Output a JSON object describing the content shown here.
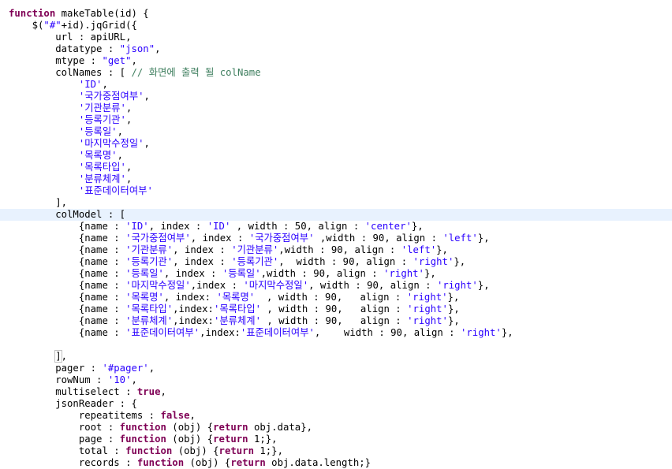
{
  "code_lines": [
    [
      {
        "t": "function",
        "c": "kw"
      },
      {
        "t": " makeTable(id) {",
        "c": "tx"
      }
    ],
    [
      {
        "t": "    $(",
        "c": "tx"
      },
      {
        "t": "\"#\"",
        "c": "str"
      },
      {
        "t": "+id).jqGrid({",
        "c": "tx"
      }
    ],
    [
      {
        "t": "        url : apiURL,",
        "c": "tx"
      }
    ],
    [
      {
        "t": "        datatype : ",
        "c": "tx"
      },
      {
        "t": "\"json\"",
        "c": "str"
      },
      {
        "t": ",",
        "c": "tx"
      }
    ],
    [
      {
        "t": "        mtype : ",
        "c": "tx"
      },
      {
        "t": "\"get\"",
        "c": "str"
      },
      {
        "t": ",",
        "c": "tx"
      }
    ],
    [
      {
        "t": "        colNames : [ ",
        "c": "tx"
      },
      {
        "t": "// 화면에 출력 될 colName",
        "c": "cm"
      }
    ],
    [
      {
        "t": "            ",
        "c": "tx"
      },
      {
        "t": "'ID'",
        "c": "str"
      },
      {
        "t": ",",
        "c": "tx"
      }
    ],
    [
      {
        "t": "            ",
        "c": "tx"
      },
      {
        "t": "'국가중점여부'",
        "c": "str"
      },
      {
        "t": ",",
        "c": "tx"
      }
    ],
    [
      {
        "t": "            ",
        "c": "tx"
      },
      {
        "t": "'기관분류'",
        "c": "str"
      },
      {
        "t": ",",
        "c": "tx"
      }
    ],
    [
      {
        "t": "            ",
        "c": "tx"
      },
      {
        "t": "'등록기관'",
        "c": "str"
      },
      {
        "t": ",",
        "c": "tx"
      }
    ],
    [
      {
        "t": "            ",
        "c": "tx"
      },
      {
        "t": "'등록일'",
        "c": "str"
      },
      {
        "t": ",",
        "c": "tx"
      }
    ],
    [
      {
        "t": "            ",
        "c": "tx"
      },
      {
        "t": "'마지막수정일'",
        "c": "str"
      },
      {
        "t": ",",
        "c": "tx"
      }
    ],
    [
      {
        "t": "            ",
        "c": "tx"
      },
      {
        "t": "'목록명'",
        "c": "str"
      },
      {
        "t": ",",
        "c": "tx"
      }
    ],
    [
      {
        "t": "            ",
        "c": "tx"
      },
      {
        "t": "'목록타입'",
        "c": "str"
      },
      {
        "t": ",",
        "c": "tx"
      }
    ],
    [
      {
        "t": "            ",
        "c": "tx"
      },
      {
        "t": "'분류체계'",
        "c": "str"
      },
      {
        "t": ",",
        "c": "tx"
      }
    ],
    [
      {
        "t": "            ",
        "c": "tx"
      },
      {
        "t": "'표준데이터여부'",
        "c": "str"
      }
    ],
    [
      {
        "t": "        ],",
        "c": "tx"
      }
    ],
    [
      {
        "t": "        colModel : [",
        "c": "tx"
      }
    ],
    [
      {
        "t": "            {name : ",
        "c": "tx"
      },
      {
        "t": "'ID'",
        "c": "str"
      },
      {
        "t": ", index : ",
        "c": "tx"
      },
      {
        "t": "'ID'",
        "c": "str"
      },
      {
        "t": " , width : 50, align : ",
        "c": "tx"
      },
      {
        "t": "'center'",
        "c": "str"
      },
      {
        "t": "},",
        "c": "tx"
      }
    ],
    [
      {
        "t": "            {name : ",
        "c": "tx"
      },
      {
        "t": "'국가중점여부'",
        "c": "str"
      },
      {
        "t": ", index : ",
        "c": "tx"
      },
      {
        "t": "'국가중점여부'",
        "c": "str"
      },
      {
        "t": " ,width : 90, align : ",
        "c": "tx"
      },
      {
        "t": "'left'",
        "c": "str"
      },
      {
        "t": "},",
        "c": "tx"
      }
    ],
    [
      {
        "t": "            {name : ",
        "c": "tx"
      },
      {
        "t": "'기관분류'",
        "c": "str"
      },
      {
        "t": ", index : ",
        "c": "tx"
      },
      {
        "t": "'기관분류'",
        "c": "str"
      },
      {
        "t": ",width : 90, align : ",
        "c": "tx"
      },
      {
        "t": "'left'",
        "c": "str"
      },
      {
        "t": "},",
        "c": "tx"
      }
    ],
    [
      {
        "t": "            {name : ",
        "c": "tx"
      },
      {
        "t": "'등록기관'",
        "c": "str"
      },
      {
        "t": ", index : ",
        "c": "tx"
      },
      {
        "t": "'등록기관'",
        "c": "str"
      },
      {
        "t": ",  width : 90, align : ",
        "c": "tx"
      },
      {
        "t": "'right'",
        "c": "str"
      },
      {
        "t": "},",
        "c": "tx"
      }
    ],
    [
      {
        "t": "            {name : ",
        "c": "tx"
      },
      {
        "t": "'등록일'",
        "c": "str"
      },
      {
        "t": ", index : ",
        "c": "tx"
      },
      {
        "t": "'등록일'",
        "c": "str"
      },
      {
        "t": ",width : 90, align : ",
        "c": "tx"
      },
      {
        "t": "'right'",
        "c": "str"
      },
      {
        "t": "},",
        "c": "tx"
      }
    ],
    [
      {
        "t": "            {name : ",
        "c": "tx"
      },
      {
        "t": "'마지막수정일'",
        "c": "str"
      },
      {
        "t": ",index : ",
        "c": "tx"
      },
      {
        "t": "'마지막수정일'",
        "c": "str"
      },
      {
        "t": ", width : 90, align : ",
        "c": "tx"
      },
      {
        "t": "'right'",
        "c": "str"
      },
      {
        "t": "},",
        "c": "tx"
      }
    ],
    [
      {
        "t": "            {name : ",
        "c": "tx"
      },
      {
        "t": "'목록명'",
        "c": "str"
      },
      {
        "t": ", index: ",
        "c": "tx"
      },
      {
        "t": "'목록명'",
        "c": "str"
      },
      {
        "t": "  , width : 90,   align : ",
        "c": "tx"
      },
      {
        "t": "'right'",
        "c": "str"
      },
      {
        "t": "},",
        "c": "tx"
      }
    ],
    [
      {
        "t": "            {name : ",
        "c": "tx"
      },
      {
        "t": "'목록타입'",
        "c": "str"
      },
      {
        "t": ",index:",
        "c": "tx"
      },
      {
        "t": "'목록타입'",
        "c": "str"
      },
      {
        "t": " , width : 90,   align : ",
        "c": "tx"
      },
      {
        "t": "'right'",
        "c": "str"
      },
      {
        "t": "},",
        "c": "tx"
      }
    ],
    [
      {
        "t": "            {name : ",
        "c": "tx"
      },
      {
        "t": "'분류체계'",
        "c": "str"
      },
      {
        "t": ",index:",
        "c": "tx"
      },
      {
        "t": "'분류체계'",
        "c": "str"
      },
      {
        "t": " , width : 90,   align : ",
        "c": "tx"
      },
      {
        "t": "'right'",
        "c": "str"
      },
      {
        "t": "},",
        "c": "tx"
      }
    ],
    [
      {
        "t": "            {name : ",
        "c": "tx"
      },
      {
        "t": "'표준데이터여부'",
        "c": "str"
      },
      {
        "t": ",index:",
        "c": "tx"
      },
      {
        "t": "'표준데이터여부'",
        "c": "str"
      },
      {
        "t": ",    width : 90, align : ",
        "c": "tx"
      },
      {
        "t": "'right'",
        "c": "str"
      },
      {
        "t": "},",
        "c": "tx"
      }
    ],
    [],
    [
      {
        "t": "        ",
        "c": "tx"
      },
      {
        "t": "]",
        "c": "tx",
        "box": true
      },
      {
        "t": ",",
        "c": "tx"
      }
    ],
    [
      {
        "t": "        pager : ",
        "c": "tx"
      },
      {
        "t": "'#pager'",
        "c": "str"
      },
      {
        "t": ",",
        "c": "tx"
      }
    ],
    [
      {
        "t": "        rowNum : ",
        "c": "tx"
      },
      {
        "t": "'10'",
        "c": "str"
      },
      {
        "t": ",",
        "c": "tx"
      }
    ],
    [
      {
        "t": "        multiselect : ",
        "c": "tx"
      },
      {
        "t": "true",
        "c": "kw"
      },
      {
        "t": ",",
        "c": "tx"
      }
    ],
    [
      {
        "t": "        jsonReader : {",
        "c": "tx"
      }
    ],
    [
      {
        "t": "            repeatitems : ",
        "c": "tx"
      },
      {
        "t": "false",
        "c": "kw"
      },
      {
        "t": ",",
        "c": "tx"
      }
    ],
    [
      {
        "t": "            root : ",
        "c": "tx"
      },
      {
        "t": "function",
        "c": "kw"
      },
      {
        "t": " (obj) {",
        "c": "tx"
      },
      {
        "t": "return",
        "c": "kw"
      },
      {
        "t": " obj.data},",
        "c": "tx"
      }
    ],
    [
      {
        "t": "            page : ",
        "c": "tx"
      },
      {
        "t": "function",
        "c": "kw"
      },
      {
        "t": " (obj) {",
        "c": "tx"
      },
      {
        "t": "return",
        "c": "kw"
      },
      {
        "t": " 1;},",
        "c": "tx"
      }
    ],
    [
      {
        "t": "            total : ",
        "c": "tx"
      },
      {
        "t": "function",
        "c": "kw"
      },
      {
        "t": " (obj) {",
        "c": "tx"
      },
      {
        "t": "return",
        "c": "kw"
      },
      {
        "t": " 1;},",
        "c": "tx"
      }
    ],
    [
      {
        "t": "            records : ",
        "c": "tx"
      },
      {
        "t": "function",
        "c": "kw"
      },
      {
        "t": " (obj) {",
        "c": "tx"
      },
      {
        "t": "return",
        "c": "kw"
      },
      {
        "t": " obj.data.length;}",
        "c": "tx"
      }
    ]
  ],
  "highlighted_line_index": 17,
  "colors": {
    "keyword": "#7f0055",
    "string": "#2a00ff",
    "comment": "#3f7f5f",
    "current_line": "#e8f2fe"
  }
}
